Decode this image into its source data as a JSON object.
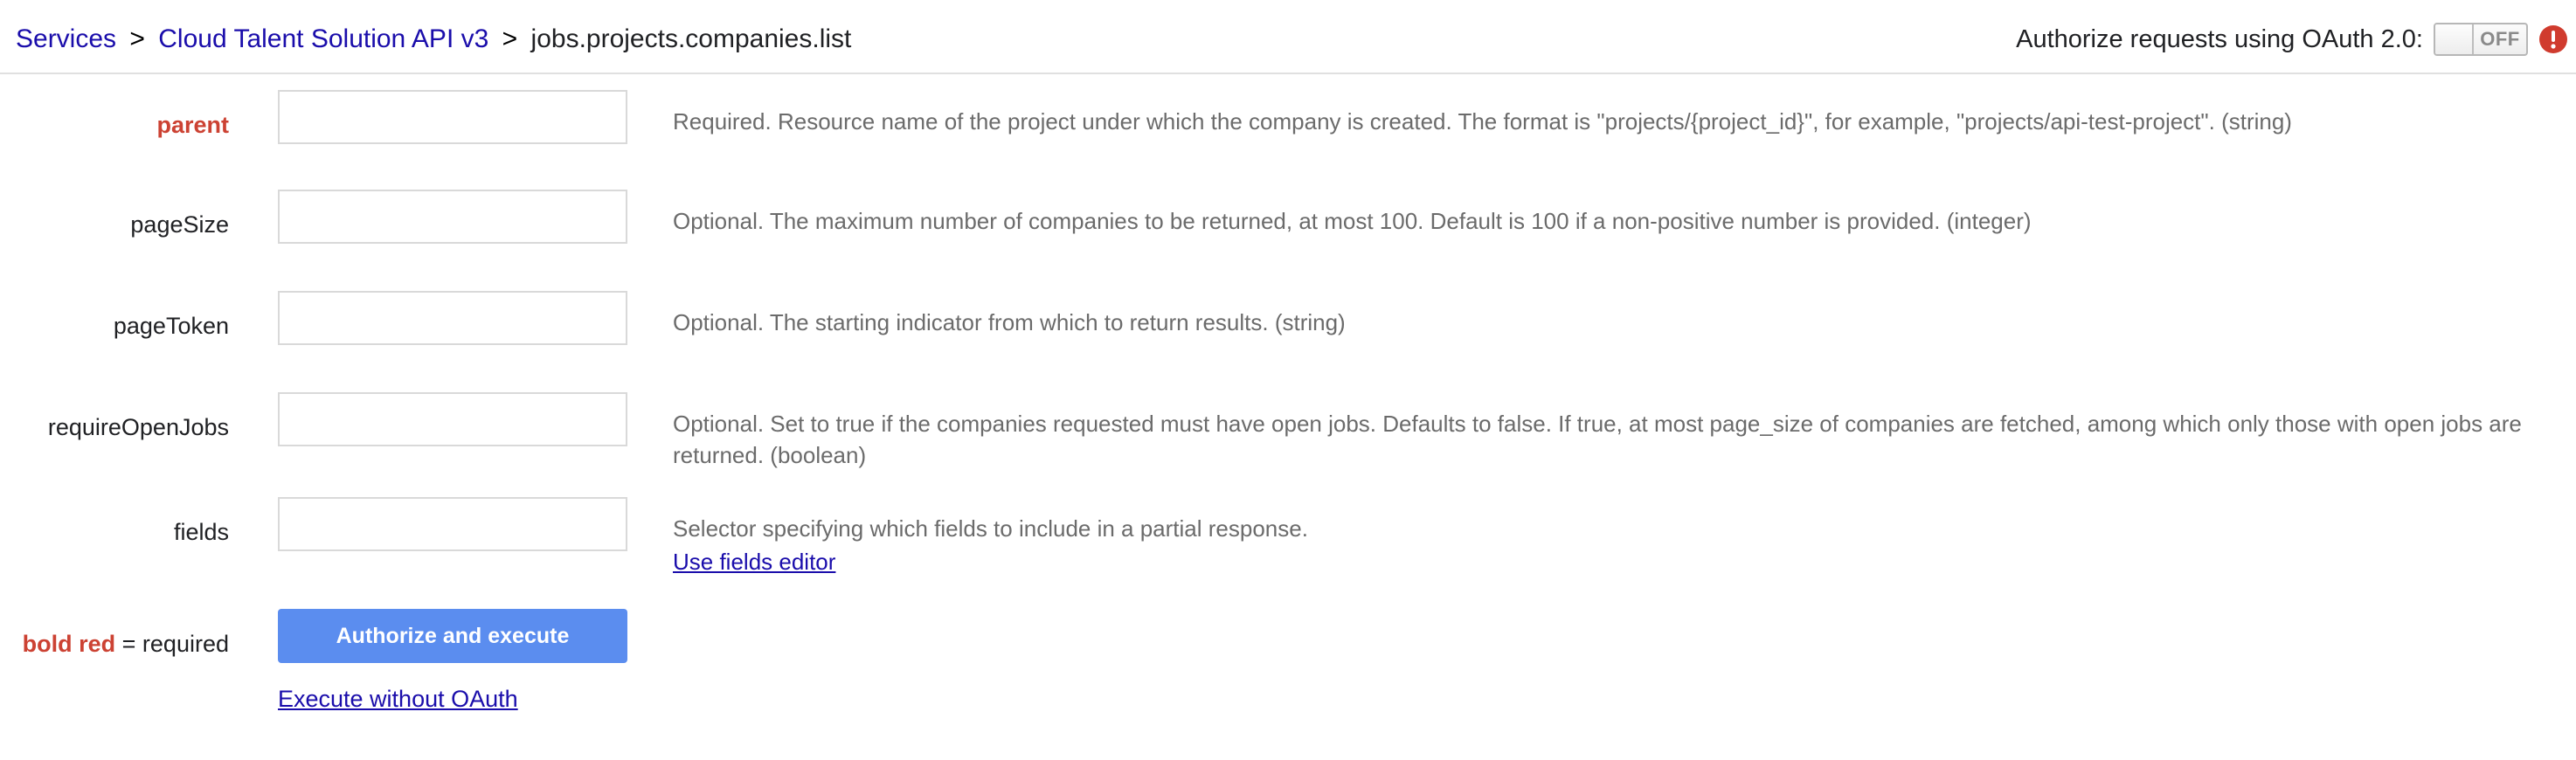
{
  "header": {
    "breadcrumb": {
      "services": "Services",
      "separator": ">",
      "api": "Cloud Talent Solution API v3",
      "method": "jobs.projects.companies.list"
    },
    "oauth": {
      "label": "Authorize requests using OAuth 2.0:",
      "toggle_state": "OFF",
      "warning_icon": "error-circle-icon"
    }
  },
  "parameters": [
    {
      "name": "parent",
      "required": true,
      "value": "",
      "placeholder": "",
      "description": "Required. Resource name of the project under which the company is created. The format is \"projects/{project_id}\", for example, \"projects/api-test-project\". (string)"
    },
    {
      "name": "pageSize",
      "required": false,
      "value": "",
      "placeholder": "",
      "description": "Optional. The maximum number of companies to be returned, at most 100. Default is 100 if a non-positive number is provided. (integer)"
    },
    {
      "name": "pageToken",
      "required": false,
      "value": "",
      "placeholder": "",
      "description": "Optional. The starting indicator from which to return results. (string)"
    },
    {
      "name": "requireOpenJobs",
      "required": false,
      "value": "",
      "placeholder": "",
      "description": "Optional. Set to true if the companies requested must have open jobs. Defaults to false. If true, at most page_size of companies are fetched, among which only those with open jobs are returned. (boolean)"
    },
    {
      "name": "fields",
      "required": false,
      "value": "",
      "placeholder": "",
      "description": "Selector specifying which fields to include in a partial response.",
      "link_label": "Use fields editor"
    }
  ],
  "footer": {
    "legend_bold_red": "bold red",
    "legend_rest": " = required",
    "primary_button": "Authorize and execute",
    "secondary_link": "Execute without OAuth"
  },
  "colors": {
    "link": "#1a0dab",
    "required": "#cc4233",
    "primary_button": "#5b8def",
    "description_text": "#6b6b6b",
    "warning_icon": "#d03b2e",
    "field_border": "#d9d9d9"
  }
}
